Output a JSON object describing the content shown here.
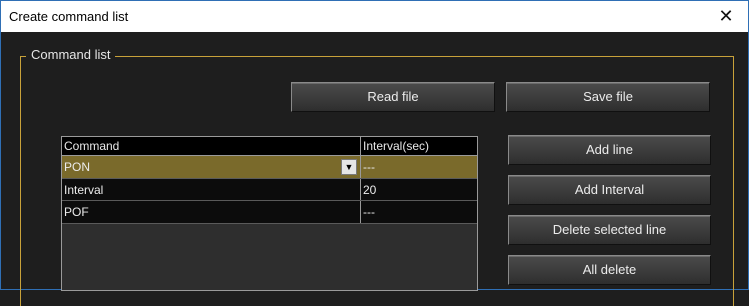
{
  "window": {
    "title": "Create command list",
    "close_glyph": "✕",
    "close_icon": "close-icon"
  },
  "group": {
    "legend": "Command list"
  },
  "file_buttons": {
    "read_label": "Read file",
    "save_label": "Save file"
  },
  "table": {
    "columns": [
      "Command",
      "Interval(sec)"
    ],
    "rows": [
      {
        "command": "PON",
        "interval": "---",
        "selected": true
      },
      {
        "command": "Interval",
        "interval": "20",
        "selected": false
      },
      {
        "command": "POF",
        "interval": "---",
        "selected": false
      }
    ],
    "dropdown_glyph": "▼",
    "dropdown_icon": "chevron-down-icon"
  },
  "side_buttons": {
    "add_line": "Add line",
    "add_interval": "Add Interval",
    "delete_selected": "Delete selected line",
    "all_delete": "All delete"
  },
  "colors": {
    "selected_row": "#7a6a2b",
    "group_border": "#c8a23a",
    "background": "#1e1e1e"
  }
}
